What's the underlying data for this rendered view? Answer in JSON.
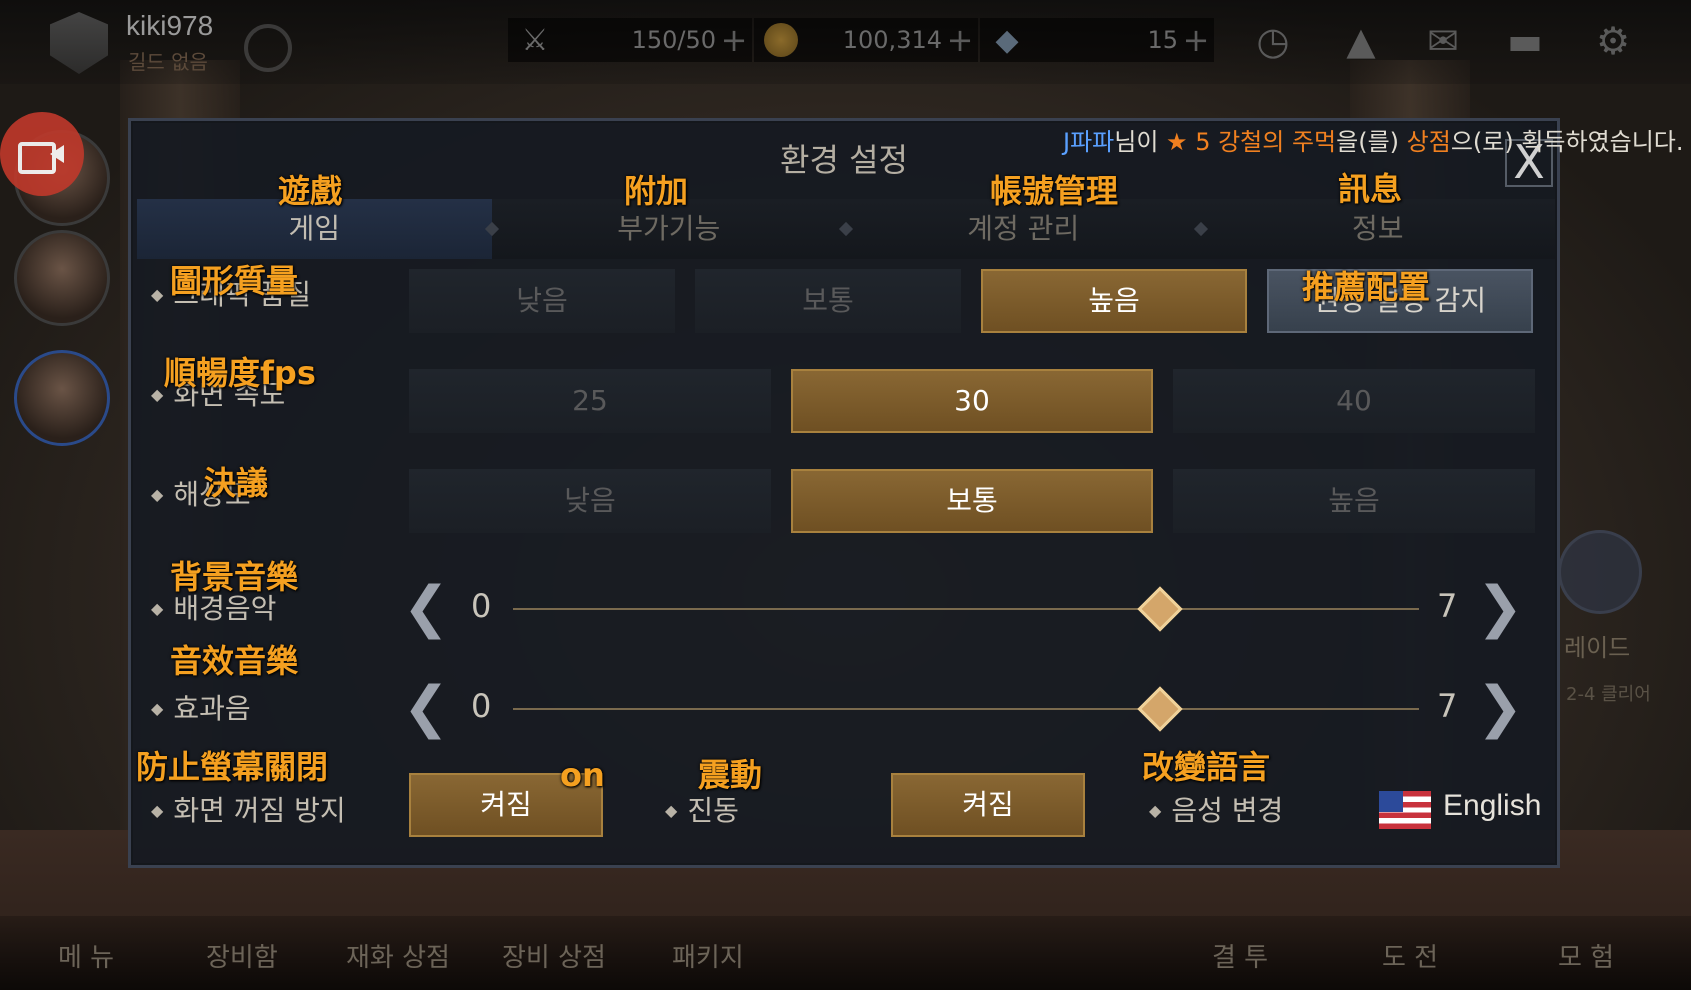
{
  "hud": {
    "player_name": "kiki978",
    "guild_name": "길드 없음",
    "stamina": "150/50",
    "gold": "100,314",
    "gems": "15"
  },
  "notification": {
    "player": "J파파",
    "text1": "님이 ",
    "star": "★ 5 ",
    "item": "강철의 주먹",
    "text2": "을(를) ",
    "place": "상점",
    "text3": "으(로) 획득하였습니다."
  },
  "dialog": {
    "title": "환경 설정",
    "close_label": "X",
    "tabs": [
      {
        "label": "게임",
        "caption": "遊戲"
      },
      {
        "label": "부가기능",
        "caption": "附加"
      },
      {
        "label": "계정 관리",
        "caption": "帳號管理"
      },
      {
        "label": "정보",
        "caption": "訊息"
      }
    ],
    "graphics": {
      "label": "그래픽 품질",
      "caption": "圖形質量",
      "options": [
        "낮음",
        "보통",
        "높음"
      ],
      "selected": "높음",
      "detect_label": "권장 설정 감지",
      "detect_caption": "推薦配置"
    },
    "fps": {
      "label": "화면 속도",
      "caption": "順暢度fps",
      "options": [
        "25",
        "30",
        "40"
      ],
      "selected": "30"
    },
    "resolution": {
      "label": "해상도",
      "caption": "決議",
      "options": [
        "낮음",
        "보통",
        "높음"
      ],
      "selected": "보통"
    },
    "bgm": {
      "label": "배경음악",
      "caption": "背景音樂",
      "min": "0",
      "max": "7",
      "value": 5
    },
    "sfx": {
      "label": "효과음",
      "caption": "音效音樂",
      "min": "0",
      "max": "7",
      "value": 5
    },
    "screen_off": {
      "label": "화면 꺼짐 방지",
      "caption": "防止螢幕關閉",
      "value": "켜짐",
      "value_caption": "on"
    },
    "vibration": {
      "label": "진동",
      "caption": "震動",
      "value": "켜짐"
    },
    "voice": {
      "label": "음성 변경",
      "caption": "改變語言",
      "value": "English"
    }
  },
  "side": {
    "raid_label": "레이드",
    "raid_sub": "2-4 클리어"
  },
  "bottom_nav": [
    "메 뉴",
    "장비함",
    "재화 상점",
    "장비 상점",
    "패키지",
    "결 투",
    "도 전",
    "모 험"
  ]
}
